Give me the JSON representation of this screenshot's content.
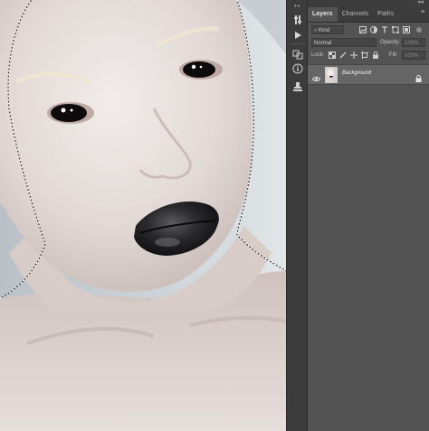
{
  "toolbar": {
    "tools": [
      {
        "icon": "adjust-icon"
      },
      {
        "icon": "play-icon"
      },
      {
        "icon": "layer-comp-icon"
      },
      {
        "icon": "info-icon"
      },
      {
        "icon": "clone-source-icon"
      }
    ]
  },
  "layers_panel": {
    "tabs": [
      {
        "label": "Layers",
        "active": true
      },
      {
        "label": "Channels",
        "active": false
      },
      {
        "label": "Paths",
        "active": false
      }
    ],
    "filter": {
      "kind_label": "Kind"
    },
    "blend_mode": "Normal",
    "opacity_label": "Opacity:",
    "opacity_value": "100%",
    "lock_label": "Lock:",
    "fill_label": "Fill:",
    "fill_value": "100%",
    "layers": [
      {
        "name": "Background",
        "visible": true,
        "locked": true
      }
    ]
  },
  "colors": {
    "panel_bg": "#535353",
    "toolbar_bg": "#3c3c3c",
    "selected_layer": "#666666"
  }
}
